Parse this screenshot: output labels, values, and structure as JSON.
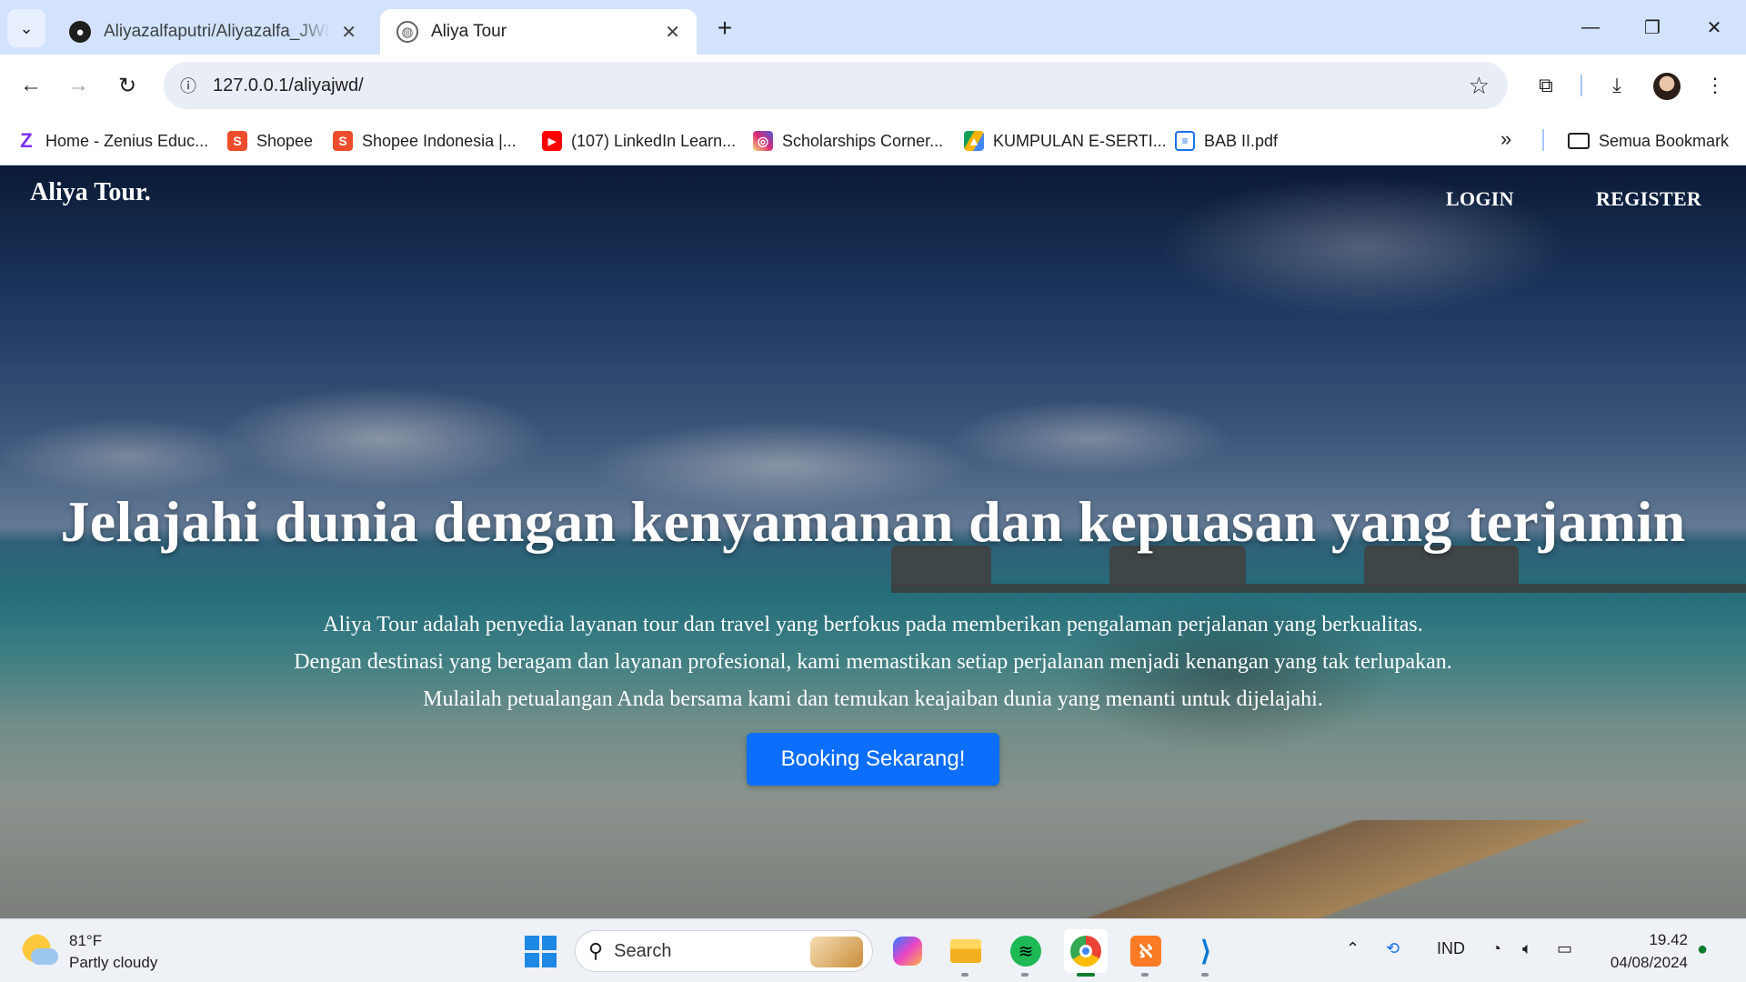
{
  "browser": {
    "tabs": [
      {
        "title": "Aliyazalfaputri/Aliyazalfa_JWD: I",
        "favicon": "github-icon",
        "active": false
      },
      {
        "title": "Aliya Tour",
        "favicon": "globe-icon",
        "active": true
      }
    ],
    "address": "127.0.0.1/aliyajwd/",
    "bookmarks": [
      {
        "label": "Home - Zenius Educ...",
        "icon": "zenius-icon",
        "color": "#7b2ff7"
      },
      {
        "label": "Shopee",
        "icon": "shopee-icon",
        "color": "#ee4d2d"
      },
      {
        "label": "Shopee Indonesia |...",
        "icon": "shopee-icon",
        "color": "#ee4d2d"
      },
      {
        "label": "(107) LinkedIn Learn...",
        "icon": "youtube-icon",
        "color": "#ff0000"
      },
      {
        "label": "Scholarships Corner...",
        "icon": "instagram-icon",
        "color": "#d62976"
      },
      {
        "label": "KUMPULAN E-SERTI...",
        "icon": "google-drive-icon",
        "color": "#0f9d58"
      },
      {
        "label": "BAB II.pdf",
        "icon": "document-icon",
        "color": "#1a73e8"
      }
    ],
    "all_bookmarks": "Semua Bookmark"
  },
  "site": {
    "brand": "Aliya Tour.",
    "nav": {
      "login": "LOGIN",
      "register": "REGISTER"
    },
    "hero": {
      "heading": "Jelajahi dunia dengan kenyamanan dan kepuasan yang terjamin",
      "lines": [
        "Aliya Tour adalah penyedia layanan tour dan travel yang berfokus pada memberikan pengalaman perjalanan yang berkualitas.",
        "Dengan destinasi yang beragam dan layanan profesional, kami memastikan setiap perjalanan menjadi kenangan yang tak terlupakan.",
        "Mulailah petualangan Anda bersama kami dan temukan keajaiban dunia yang menanti untuk dijelajahi."
      ],
      "cta": "Booking Sekarang!"
    },
    "accent": "#0b6efd"
  },
  "taskbar": {
    "weather": {
      "temp": "81°F",
      "desc": "Partly cloudy"
    },
    "search_label": "Search",
    "language": "IND",
    "time": "19.42",
    "date": "04/08/2024"
  }
}
